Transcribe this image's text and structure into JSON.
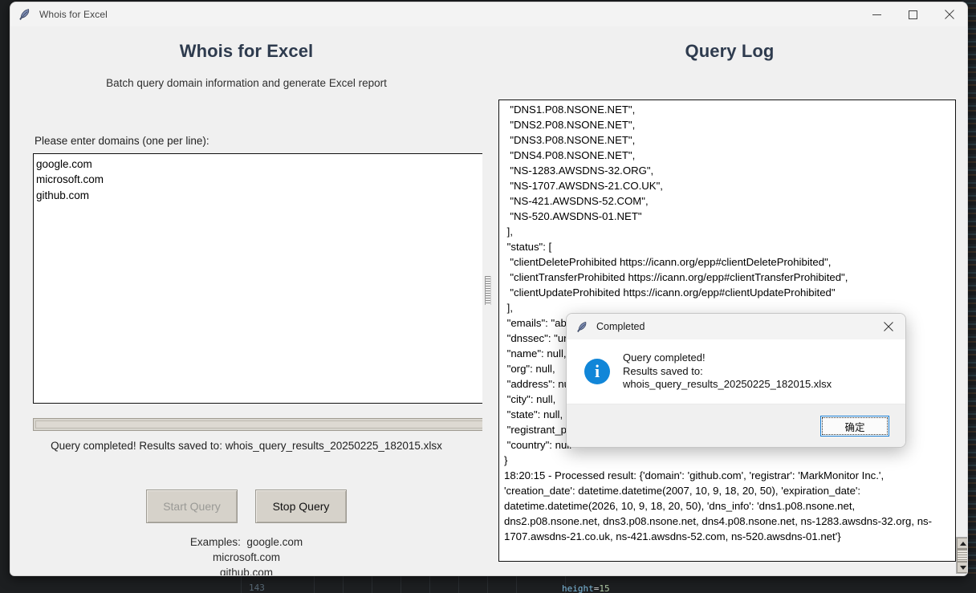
{
  "window": {
    "title": "Whois for Excel",
    "icon": "feather-icon",
    "controls": {
      "minimize": "minimize-icon",
      "maximize": "maximize-icon",
      "close": "close-icon"
    }
  },
  "left_pane": {
    "heading": "Whois for Excel",
    "subtitle": "Batch query domain information and generate Excel report",
    "input_label": "Please enter domains (one per line):",
    "domains_value": "google.com\nmicrosoft.com\ngithub.com",
    "domains_placeholder": "",
    "progress_percent": 0,
    "status": "Query completed! Results saved to: whois_query_results_20250225_182015.xlsx",
    "start_button": "Start Query",
    "start_button_disabled": true,
    "stop_button": "Stop Query",
    "examples_label": "Examples:",
    "examples": [
      "google.com",
      "microsoft.com",
      "github.com"
    ]
  },
  "right_pane": {
    "heading": "Query Log",
    "log_text": "  \"DNS1.P08.NSONE.NET\",\n  \"DNS2.P08.NSONE.NET\",\n  \"DNS3.P08.NSONE.NET\",\n  \"DNS4.P08.NSONE.NET\",\n  \"NS-1283.AWSDNS-32.ORG\",\n  \"NS-1707.AWSDNS-21.CO.UK\",\n  \"NS-421.AWSDNS-52.COM\",\n  \"NS-520.AWSDNS-01.NET\"\n ],\n \"status\": [\n  \"clientDeleteProhibited https://icann.org/epp#clientDeleteProhibited\",\n  \"clientTransferProhibited https://icann.org/epp#clientTransferProhibited\",\n  \"clientUpdateProhibited https://icann.org/epp#clientUpdateProhibited\"\n ],\n \"emails\": \"abusecomplaints@markmonitor.com\",\n \"dnssec\": \"unsigned\",\n \"name\": null,\n \"org\": null,\n \"address\": null,\n \"city\": null,\n \"state\": null,\n \"registrant_postal_code\": null,\n \"country\": null\n}\n18:20:15 - Processed result: {'domain': 'github.com', 'registrar': 'MarkMonitor Inc.', 'creation_date': datetime.datetime(2007, 10, 9, 18, 20, 50), 'expiration_date': datetime.datetime(2026, 10, 9, 18, 20, 50), 'dns_info': 'dns1.p08.nsone.net, dns2.p08.nsone.net, dns3.p08.nsone.net, dns4.p08.nsone.net, ns-1283.awsdns-32.org, ns-1707.awsdns-21.co.uk, ns-421.awsdns-52.com, ns-520.awsdns-01.net'}",
    "scrollbar": {
      "up_arrow": "scroll-up-icon",
      "down_arrow": "scroll-down-icon"
    }
  },
  "dialog": {
    "title": "Completed",
    "icon": "feather-icon",
    "close_icon": "close-icon",
    "info_icon": "info-icon",
    "message_line1": "Query completed!",
    "message_line2": "Results saved to: whois_query_results_20250225_182015.xlsx",
    "ok_button": "确定"
  },
  "background_editor": {
    "line_number": "143",
    "code_attr": "height",
    "code_op": "=",
    "code_num": "15"
  },
  "colors": {
    "heading": "#2e3b4e",
    "info_icon": "#1186d8",
    "dialog_focus": "#1a7fd4",
    "window_bg": "#f0f0f0",
    "field_bg": "#ffffff"
  }
}
